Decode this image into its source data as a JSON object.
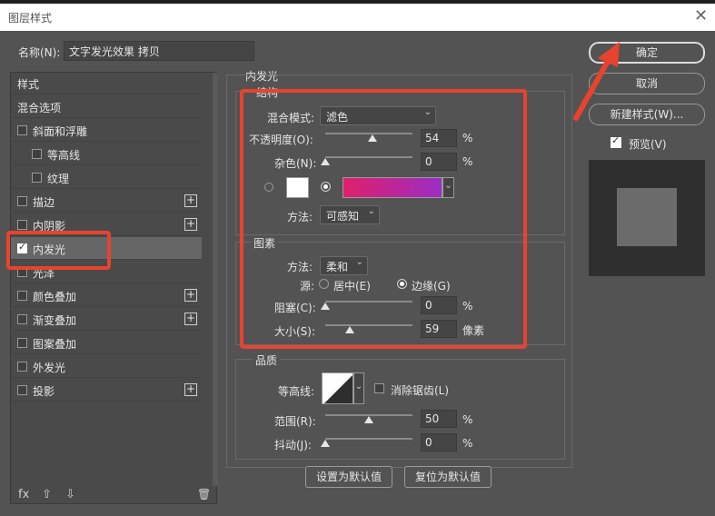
{
  "window": {
    "title": "图层样式",
    "close": "✕"
  },
  "name_field": {
    "label": "名称(N):",
    "value": "文字发光效果 拷贝"
  },
  "left_list": {
    "header": "样式",
    "items": [
      {
        "label": "混合选项",
        "checkbox": false,
        "plus": false
      },
      {
        "label": "斜面和浮雕",
        "checkbox": true,
        "checked": false,
        "plus": false
      },
      {
        "label": "等高线",
        "checkbox": true,
        "checked": false,
        "plus": false
      },
      {
        "label": "纹理",
        "checkbox": true,
        "checked": false,
        "plus": false
      },
      {
        "label": "描边",
        "checkbox": true,
        "checked": false,
        "plus": true
      },
      {
        "label": "内阴影",
        "checkbox": true,
        "checked": false,
        "plus": true
      },
      {
        "label": "内发光",
        "checkbox": true,
        "checked": true,
        "plus": false
      },
      {
        "label": "光泽",
        "checkbox": true,
        "checked": false,
        "plus": false
      },
      {
        "label": "颜色叠加",
        "checkbox": true,
        "checked": false,
        "plus": true
      },
      {
        "label": "渐变叠加",
        "checkbox": true,
        "checked": false,
        "plus": true
      },
      {
        "label": "图案叠加",
        "checkbox": true,
        "checked": false,
        "plus": false
      },
      {
        "label": "外发光",
        "checkbox": true,
        "checked": false,
        "plus": false
      },
      {
        "label": "投影",
        "checkbox": true,
        "checked": false,
        "plus": true
      }
    ],
    "footer": {
      "fx": "fx",
      "up": "⇧",
      "down": "⇩",
      "trash": "🗑"
    }
  },
  "panel": {
    "title": "内发光",
    "structure": {
      "title": "结构",
      "blend_mode_label": "混合模式:",
      "blend_mode_value": "滤色",
      "opacity_label": "不透明度(O):",
      "opacity_value": "54",
      "opacity_unit": "%",
      "opacity_level": 0.54,
      "noise_label": "杂色(N):",
      "noise_value": "0",
      "noise_unit": "%",
      "noise_level": 0,
      "method_label": "方法:",
      "method_value": "可感知",
      "gradient_colors": [
        "#e0206a",
        "#9b2ec4"
      ]
    },
    "elements": {
      "title": "图素",
      "technique_label": "方法:",
      "technique_value": "柔和",
      "source_label": "源:",
      "source_center": "居中(E)",
      "source_edge": "边缘(G)",
      "choke_label": "阻塞(C):",
      "choke_value": "0",
      "choke_unit": "%",
      "choke_level": 0,
      "size_label": "大小(S):",
      "size_value": "59",
      "size_unit": "像素",
      "size_level": 0.28
    },
    "quality": {
      "title": "品质",
      "contour_label": "等高线:",
      "antialias_label": "消除锯齿(L)",
      "range_label": "范围(R):",
      "range_value": "50",
      "range_unit": "%",
      "range_level": 0.5,
      "jitter_label": "抖动(J):",
      "jitter_value": "0",
      "jitter_unit": "%",
      "jitter_level": 0
    },
    "buttons": {
      "make_default": "设置为默认值",
      "reset_default": "复位为默认值"
    }
  },
  "right": {
    "ok": "确定",
    "cancel": "取消",
    "new_style": "新建样式(W)...",
    "preview_label": "预览(V)",
    "preview_checked": true
  },
  "colors": {
    "annotation": "#e8432e",
    "background": "#535353"
  }
}
